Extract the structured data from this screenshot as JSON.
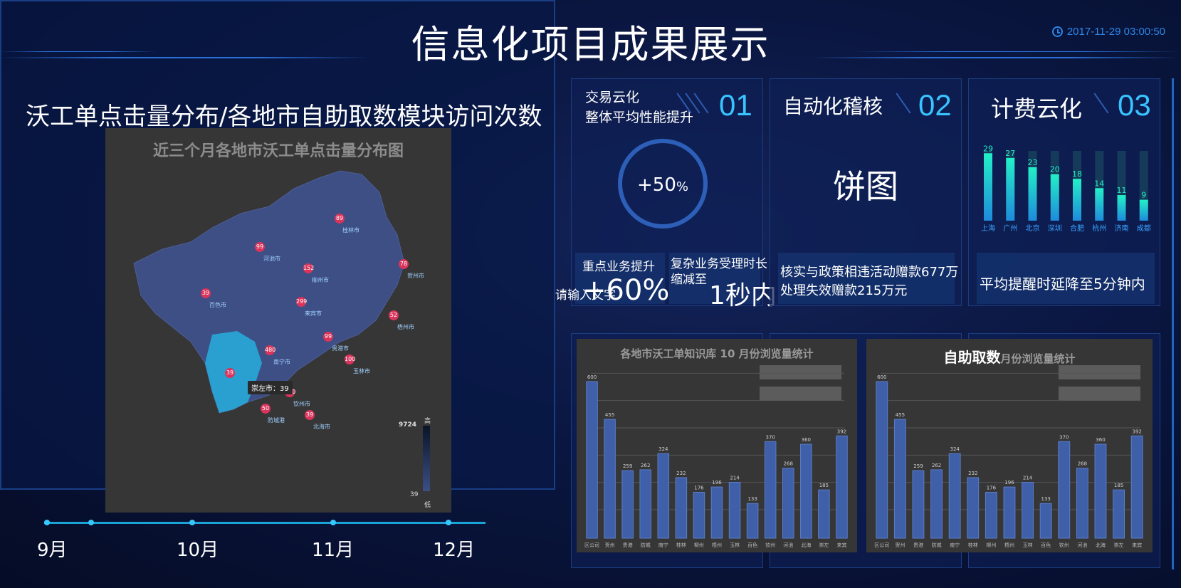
{
  "header": {
    "title": "信息化项目成果展示",
    "datetime": "2017-11-29 03:00:50"
  },
  "left": {
    "heading": "沃工单点击量分布/各地市自助取数模块访问次数",
    "map_title": "近三个月各地市沃工单点击量分布图",
    "pins": [
      {
        "value": "89",
        "city": "桂林市"
      },
      {
        "value": "99",
        "city": "河池市"
      },
      {
        "value": "152",
        "city": "柳州市"
      },
      {
        "value": "78",
        "city": "贺州市"
      },
      {
        "value": "39",
        "city": "百色市"
      },
      {
        "value": "299",
        "city": "来宾市"
      },
      {
        "value": "52",
        "city": "梧州市"
      },
      {
        "value": "99",
        "city": "贵港市"
      },
      {
        "value": "480",
        "city": "南宁市"
      },
      {
        "value": "100",
        "city": "玉林市"
      },
      {
        "value": "39",
        "city": ""
      },
      {
        "value": "200",
        "city": "钦州市"
      },
      {
        "value": "50",
        "city": "防城港"
      },
      {
        "value": "39",
        "city": "北海市"
      }
    ],
    "tooltip": "崇左市：39",
    "legend_max": "9724",
    "legend_min": "39",
    "legend_high": "高",
    "legend_low": "低",
    "timeline_months": [
      "9月",
      "10月",
      "11月",
      "12月"
    ]
  },
  "cards": [
    {
      "num": "01",
      "title_line1": "交易云化",
      "title_line2": "整体平均性能提升",
      "ring_value": "+50",
      "ring_unit": "%",
      "sub1_label": "重点业务提升",
      "sub1_overlay": "请输入文字",
      "sub1_value": "+60%",
      "sub2_label_line1": "复杂业务受理时长",
      "sub2_label_line2": "缩减至",
      "sub2_value": "1秒内"
    },
    {
      "num": "02",
      "title": "自动化稽核",
      "center": "饼图",
      "sub_line1": "核实与政策相违活动赠款677万",
      "sub_line2": "处理失效赠款215万元"
    },
    {
      "num": "03",
      "title": "计费云化",
      "sub": "平均提醒时延降至5分钟内",
      "bars": [
        {
          "city": "上海",
          "value": 29
        },
        {
          "city": "广州",
          "value": 27
        },
        {
          "city": "北京",
          "value": 23
        },
        {
          "city": "深圳",
          "value": 20
        },
        {
          "city": "合肥",
          "value": 18
        },
        {
          "city": "杭州",
          "value": 14
        },
        {
          "city": "济南",
          "value": 11
        },
        {
          "city": "成都",
          "value": 9
        }
      ]
    }
  ],
  "bottom_left": {
    "title": "各地市沃工单知识库 10 月份浏览量统计"
  },
  "bottom_right": {
    "title_strong": "自助取数",
    "title_rest": "月份浏览量统计"
  },
  "chart_data": [
    {
      "type": "bar",
      "title": "各地市沃工单知识库 10 月份浏览量统计",
      "categories": [
        "区公司",
        "贺州",
        "贵港",
        "防城",
        "南宁",
        "桂林",
        "柳州",
        "梧州",
        "玉林",
        "百色",
        "钦州",
        "河池",
        "北海",
        "崇左",
        "来宾"
      ],
      "values": [
        600,
        455,
        259,
        262,
        324,
        232,
        176,
        196,
        214,
        133,
        370,
        268,
        360,
        185,
        392
      ],
      "ylim": [
        0,
        600
      ]
    },
    {
      "type": "bar",
      "title": "自助取数月份浏览量统计",
      "categories": [
        "区公司",
        "贺州",
        "贵港",
        "防城",
        "南宁",
        "桂林",
        "柳州",
        "梧州",
        "玉林",
        "百色",
        "钦州",
        "河池",
        "北海",
        "崇左",
        "来宾"
      ],
      "values": [
        600,
        455,
        259,
        262,
        324,
        232,
        176,
        196,
        214,
        133,
        370,
        268,
        360,
        185,
        392
      ],
      "ylim": [
        0,
        600
      ]
    }
  ],
  "colors": {
    "accent": "#38c4ff",
    "pin": "#d9345b",
    "bar_gradient_top": "#23f0c7",
    "bar_gradient_bottom": "#1e8bdc",
    "bottom_bar": "#3f5fa8"
  }
}
